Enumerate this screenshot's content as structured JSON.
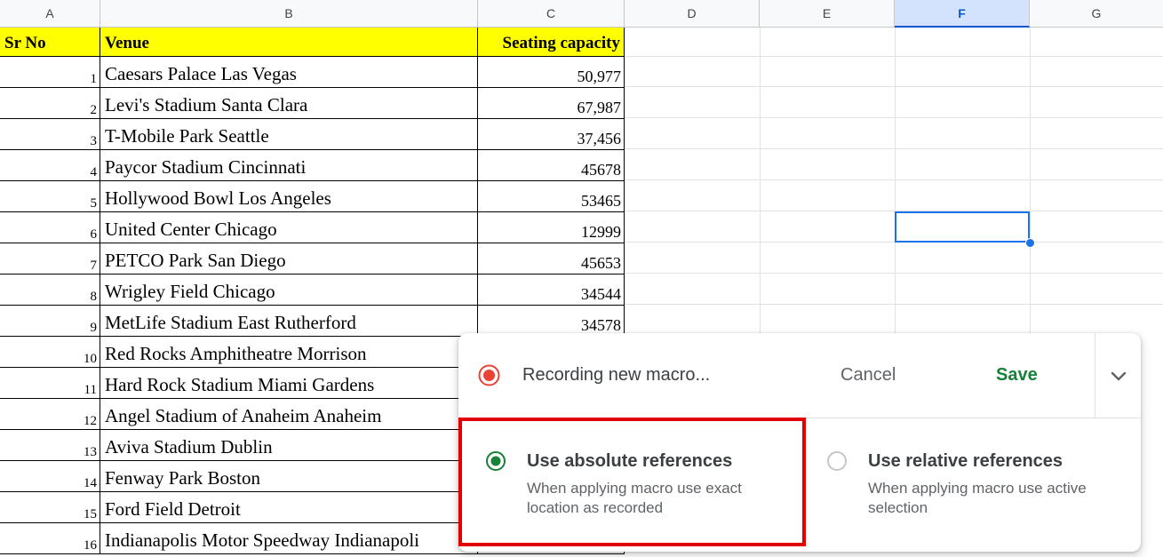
{
  "columns": [
    "A",
    "B",
    "C",
    "D",
    "E",
    "F",
    "G"
  ],
  "selected_column": "F",
  "table_header": {
    "sr_no": "Sr No",
    "venue": "Venue",
    "capacity": "Seating capacity"
  },
  "rows": [
    {
      "sr": "1",
      "venue": "Caesars Palace Las Vegas",
      "capacity": "50,977"
    },
    {
      "sr": "2",
      "venue": "Levi's Stadium Santa Clara",
      "capacity": "67,987"
    },
    {
      "sr": "3",
      "venue": "T-Mobile Park Seattle",
      "capacity": "37,456"
    },
    {
      "sr": "4",
      "venue": "Paycor Stadium Cincinnati",
      "capacity": "45678"
    },
    {
      "sr": "5",
      "venue": "Hollywood Bowl Los Angeles",
      "capacity": "53465"
    },
    {
      "sr": "6",
      "venue": "United Center Chicago",
      "capacity": "12999"
    },
    {
      "sr": "7",
      "venue": "PETCO Park San Diego",
      "capacity": "45653"
    },
    {
      "sr": "8",
      "venue": "Wrigley Field Chicago",
      "capacity": "34544"
    },
    {
      "sr": "9",
      "venue": "MetLife Stadium East Rutherford",
      "capacity": "34578"
    },
    {
      "sr": "10",
      "venue": "Red Rocks Amphitheatre Morrison",
      "capacity": ""
    },
    {
      "sr": "11",
      "venue": "Hard Rock Stadium Miami Gardens",
      "capacity": ""
    },
    {
      "sr": "12",
      "venue": "Angel Stadium of Anaheim Anaheim",
      "capacity": ""
    },
    {
      "sr": "13",
      "venue": "Aviva Stadium Dublin",
      "capacity": ""
    },
    {
      "sr": "14",
      "venue": "Fenway Park Boston",
      "capacity": ""
    },
    {
      "sr": "15",
      "venue": "Ford Field Detroit",
      "capacity": ""
    },
    {
      "sr": "16",
      "venue": "Indianapolis Motor Speedway Indianapoli",
      "capacity": ""
    }
  ],
  "macro": {
    "title": "Recording new macro...",
    "cancel_label": "Cancel",
    "save_label": "Save",
    "absolute": {
      "title": "Use absolute references",
      "description": "When applying macro use exact location as recorded",
      "selected": true
    },
    "relative": {
      "title": "Use relative references",
      "description": "When applying macro use active selection",
      "selected": false
    }
  },
  "colors": {
    "header_fill": "#ffff00",
    "selection": "#1a73e8",
    "record": "#ea4335",
    "save": "#188038",
    "radio_selected": "#188038",
    "highlight": "#e00000"
  },
  "icons": [
    "record-icon",
    "chevron-down-icon",
    "radio-selected-icon",
    "radio-unselected-icon"
  ]
}
